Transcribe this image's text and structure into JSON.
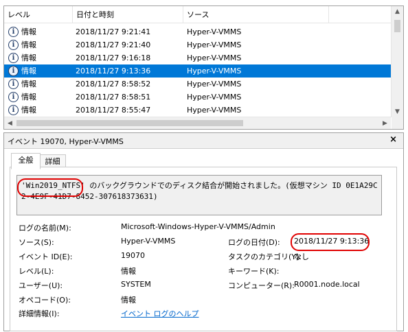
{
  "list": {
    "columns": [
      "レベル",
      "日付と時刻",
      "ソース"
    ],
    "rows": [
      {
        "level": "情報",
        "datetime": "2018/11/27 9:21:41",
        "source": "Hyper-V-VMMS"
      },
      {
        "level": "情報",
        "datetime": "2018/11/27 9:21:40",
        "source": "Hyper-V-VMMS"
      },
      {
        "level": "情報",
        "datetime": "2018/11/27 9:16:18",
        "source": "Hyper-V-VMMS"
      },
      {
        "level": "情報",
        "datetime": "2018/11/27 9:13:36",
        "source": "Hyper-V-VMMS"
      },
      {
        "level": "情報",
        "datetime": "2018/11/27 8:58:52",
        "source": "Hyper-V-VMMS"
      },
      {
        "level": "情報",
        "datetime": "2018/11/27 8:58:51",
        "source": "Hyper-V-VMMS"
      },
      {
        "level": "情報",
        "datetime": "2018/11/27 8:55:47",
        "source": "Hyper-V-VMMS"
      }
    ]
  },
  "detail": {
    "title": "イベント 19070, Hyper-V-VMMS",
    "close_label": "×",
    "tabs": [
      "全般",
      "詳細"
    ],
    "message": "'Win2019_NTFS' のバックグラウンドでのディスク結合が開始されました。(仮想マシン ID 0E1A29C2-4E9F-41D7-8452-307618373631)",
    "fields": {
      "log_name_label": "ログの名前(M):",
      "log_name": "Microsoft-Windows-Hyper-V-VMMS/Admin",
      "source_label": "ソース(S):",
      "source": "Hyper-V-VMMS",
      "logged_label": "ログの日付(D):",
      "logged": "2018/11/27 9:13:36",
      "event_id_label": "イベント ID(E):",
      "event_id": "19070",
      "task_label": "タスクのカテゴリ(Y):",
      "task": "なし",
      "level_label": "レベル(L):",
      "level": "情報",
      "keywords_label": "キーワード(K):",
      "keywords": "",
      "user_label": "ユーザー(U):",
      "user": "SYSTEM",
      "computer_label": "コンピューター(R):",
      "computer": "R0001.node.local",
      "opcode_label": "オペコード(O):",
      "opcode": "情報",
      "more_info_label": "詳細情報(I):",
      "more_info_link": "イベント ログのヘルプ"
    }
  },
  "colors": {
    "selection": "#0078d7",
    "highlight": "#e00000",
    "link": "#0066cc"
  }
}
